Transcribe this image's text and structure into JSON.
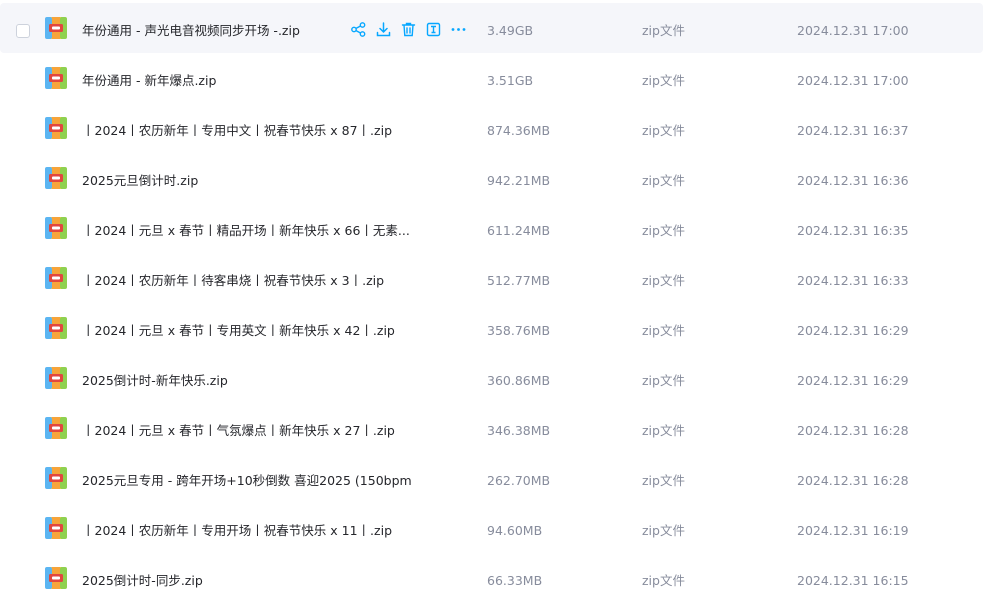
{
  "colors": {
    "accent": "#06a7ff",
    "hover_row": "#f5f6fa",
    "text": "#25262b",
    "muted": "#878c9c"
  },
  "actions": [
    {
      "name": "share-icon"
    },
    {
      "name": "download-icon"
    },
    {
      "name": "delete-icon"
    },
    {
      "name": "rename-icon"
    },
    {
      "name": "more-icon"
    }
  ],
  "files": [
    {
      "name": "年份通用 - 声光电音视频同步开场 -.zip",
      "size": "3.49GB",
      "type": "zip文件",
      "date": "2024.12.31 17:00",
      "hover": true
    },
    {
      "name": "年份通用 - 新年爆点.zip",
      "size": "3.51GB",
      "type": "zip文件",
      "date": "2024.12.31 17:00"
    },
    {
      "name": "丨2024丨农历新年丨专用中文丨祝春节快乐 x 87丨.zip",
      "size": "874.36MB",
      "type": "zip文件",
      "date": "2024.12.31 16:37"
    },
    {
      "name": "2025元旦倒计时.zip",
      "size": "942.21MB",
      "type": "zip文件",
      "date": "2024.12.31 16:36"
    },
    {
      "name": "丨2024丨元旦 x 春节丨精品开场丨新年快乐 x 66丨无素...",
      "size": "611.24MB",
      "type": "zip文件",
      "date": "2024.12.31 16:35"
    },
    {
      "name": "丨2024丨农历新年丨待客串烧丨祝春节快乐 x 3丨.zip",
      "size": "512.77MB",
      "type": "zip文件",
      "date": "2024.12.31 16:33"
    },
    {
      "name": "丨2024丨元旦 x 春节丨专用英文丨新年快乐 x 42丨.zip",
      "size": "358.76MB",
      "type": "zip文件",
      "date": "2024.12.31 16:29"
    },
    {
      "name": "2025倒计时-新年快乐.zip",
      "size": "360.86MB",
      "type": "zip文件",
      "date": "2024.12.31 16:29"
    },
    {
      "name": "丨2024丨元旦 x 春节丨气氛爆点丨新年快乐 x 27丨.zip",
      "size": "346.38MB",
      "type": "zip文件",
      "date": "2024.12.31 16:28"
    },
    {
      "name": "2025元旦专用 - 跨年开场+10秒倒数 喜迎2025 (150bpm...",
      "size": "262.70MB",
      "type": "zip文件",
      "date": "2024.12.31 16:28"
    },
    {
      "name": "丨2024丨农历新年丨专用开场丨祝春节快乐 x 11丨.zip",
      "size": "94.60MB",
      "type": "zip文件",
      "date": "2024.12.31 16:19"
    },
    {
      "name": "2025倒计时-同步.zip",
      "size": "66.33MB",
      "type": "zip文件",
      "date": "2024.12.31 16:15"
    }
  ]
}
